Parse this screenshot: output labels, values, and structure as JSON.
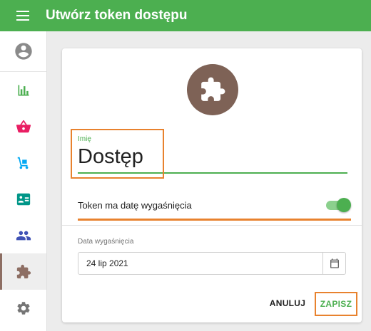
{
  "header": {
    "title": "Utwórz token dostępu",
    "menu_icon": "hamburger-menu-icon"
  },
  "sidebar": {
    "items": [
      {
        "name": "account",
        "icon": "account-circle-icon",
        "active": false
      },
      {
        "name": "stats",
        "icon": "bar-chart-icon",
        "active": false
      },
      {
        "name": "shop",
        "icon": "shopping-basket-icon",
        "active": false
      },
      {
        "name": "delivery",
        "icon": "hand-truck-icon",
        "active": false
      },
      {
        "name": "contacts",
        "icon": "contact-card-icon",
        "active": false
      },
      {
        "name": "users",
        "icon": "people-icon",
        "active": false
      },
      {
        "name": "tokens",
        "icon": "puzzle-icon",
        "active": true
      },
      {
        "name": "settings",
        "icon": "gear-icon",
        "active": false
      }
    ]
  },
  "form": {
    "avatar_icon": "puzzle-icon",
    "name_label": "Imię",
    "name_value": "Dostęp",
    "expires_toggle_label": "Token ma datę wygaśnięcia",
    "expires_toggle_on": true,
    "expiry_label": "Data wygaśnięcia",
    "expiry_value": "24 lip 2021",
    "calendar_icon": "calendar-icon",
    "cancel_label": "ANULUJ",
    "save_label": "ZAPISZ"
  },
  "colors": {
    "primary": "#4caf50",
    "highlight": "#e8822e",
    "avatar": "#7e6256",
    "stats_icon": "#4caf50",
    "shop_icon": "#e91e63",
    "delivery_icon": "#03a9f4",
    "contacts_icon": "#009688",
    "users_icon": "#3f51b5",
    "tokens_icon": "#8d6e63",
    "settings_icon": "#757575"
  }
}
